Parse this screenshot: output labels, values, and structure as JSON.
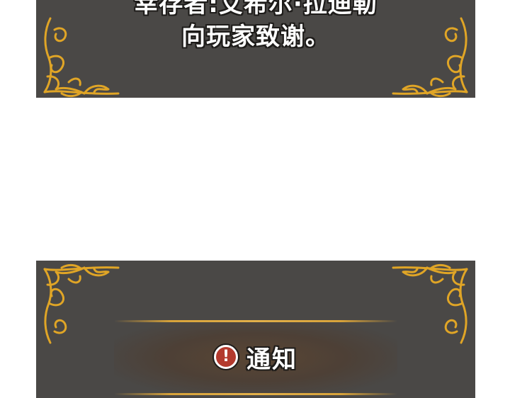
{
  "top_panel": {
    "line1": "幸存者:艾希尔·拉迪勒",
    "line2": "向玩家致谢。"
  },
  "bottom_panel": {
    "notice_icon": "exclamation-icon",
    "notice_icon_glyph": "!",
    "notice_title": "通知"
  },
  "colors": {
    "panel_bg": "#4a4846",
    "ornament_gold": "#e0a526",
    "banner_line": "#d8a33a",
    "text": "#ffffff",
    "alert_red": "#b33a2e"
  }
}
